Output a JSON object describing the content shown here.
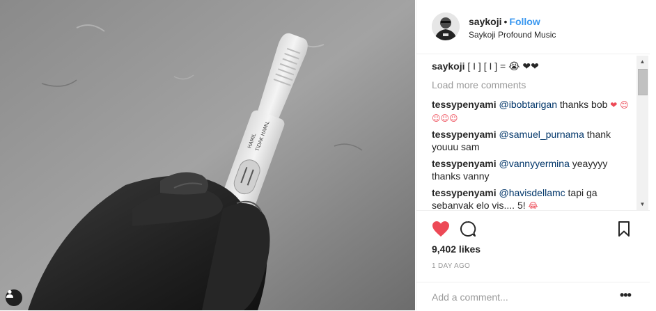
{
  "post": {
    "author": "saykoji",
    "separator": "•",
    "follow_label": "Follow",
    "location": "Saykoji Profound Music"
  },
  "photo": {
    "test_text_1": "HAMIL",
    "test_text_2": "TIDAK HAMIL"
  },
  "caption": {
    "user": "saykoji",
    "text": "[ I ] [ I ] = 😭 ❤❤"
  },
  "load_more_label": "Load more comments",
  "comments": [
    {
      "user": "tessypenyami",
      "mention": "@ibobtarigan",
      "text": " thanks bob ",
      "emoji": "❤ 😊☺☺☺"
    },
    {
      "user": "tessypenyami",
      "mention": "@samuel_purnama",
      "text": " thank youuu sam",
      "emoji": ""
    },
    {
      "user": "tessypenyami",
      "mention": "@vannyyermina",
      "text": " yeayyyy thanks vanny",
      "emoji": ""
    },
    {
      "user": "tessypenyami",
      "mention": "@havisdellamc",
      "text": " tapi ga sebanyak elo vis.... 5! ",
      "emoji": "😂"
    }
  ],
  "likes": "9,402 likes",
  "time_ago": "1 DAY AGO",
  "add_comment": {
    "placeholder": "Add a comment..."
  },
  "more_label": "•••",
  "icons": {
    "like": "heart-icon",
    "comment": "comment-icon",
    "save": "bookmark-icon",
    "user_tag": "user-tag-icon"
  },
  "colors": {
    "like": "#ed4956",
    "follow": "#3897f0",
    "mention": "#003569"
  }
}
